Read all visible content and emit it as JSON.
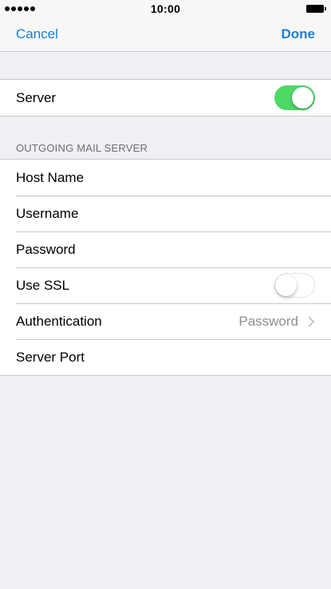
{
  "status_bar": {
    "time": "10:00",
    "signal_icon": "signal-dots-icon",
    "battery_icon": "battery-icon"
  },
  "nav": {
    "cancel_label": "Cancel",
    "done_label": "Done"
  },
  "server_group": {
    "server_label": "Server",
    "server_enabled": true
  },
  "outgoing": {
    "section_title": "OUTGOING MAIL SERVER",
    "host_name_label": "Host Name",
    "username_label": "Username",
    "password_label": "Password",
    "use_ssl_label": "Use SSL",
    "use_ssl_enabled": false,
    "authentication_label": "Authentication",
    "authentication_value": "Password",
    "server_port_label": "Server Port"
  },
  "colors": {
    "accent": "#1a7fd4",
    "toggle_on": "#4cd964",
    "background": "#efeff4"
  }
}
